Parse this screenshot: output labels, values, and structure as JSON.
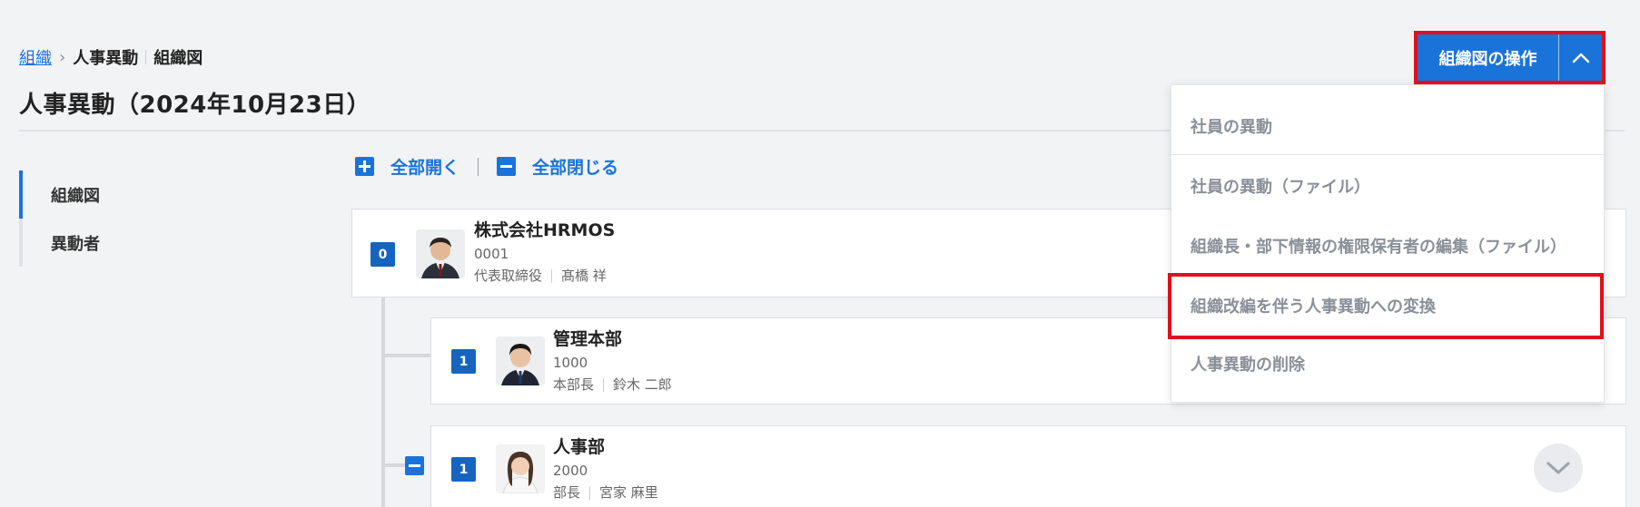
{
  "breadcrumb": {
    "root": "組織",
    "item1": "人事異動",
    "item2": "組織図"
  },
  "page": {
    "title": "人事異動（2024年10月23日）"
  },
  "sidenav": {
    "items": [
      {
        "label": "組織図"
      },
      {
        "label": "異動者"
      }
    ]
  },
  "tree_controls": {
    "expand_all": "全部開く",
    "collapse_all": "全部閉じる"
  },
  "org_units": [
    {
      "level": "0",
      "name": "株式会社HRMOS",
      "code": "0001",
      "position": "代表取締役",
      "person": "髙橋 祥"
    },
    {
      "level": "1",
      "name": "管理本部",
      "code": "1000",
      "position": "本部長",
      "person": "鈴木 二郎"
    },
    {
      "level": "1",
      "name": "人事部",
      "code": "2000",
      "position": "部長",
      "person": "宮家 麻里"
    }
  ],
  "operations": {
    "button_label": "組織図の操作",
    "menu": [
      {
        "label": "社員の異動"
      },
      {
        "label": "社員の異動（ファイル）"
      },
      {
        "label": "組織長・部下情報の権限保有者の編集（ファイル）"
      },
      {
        "label": "組織改編を伴う人事異動への変換"
      },
      {
        "label": "人事異動の削除"
      }
    ]
  },
  "colors": {
    "accent": "#1a73d9",
    "level_badge": "#1565c0",
    "highlight": "#e0101c",
    "background": "#f2f3f5"
  },
  "icons": [
    "plus-square-icon",
    "minus-square-icon",
    "chevron-up-icon",
    "chevron-down-icon",
    "breadcrumb-chevron-icon"
  ]
}
